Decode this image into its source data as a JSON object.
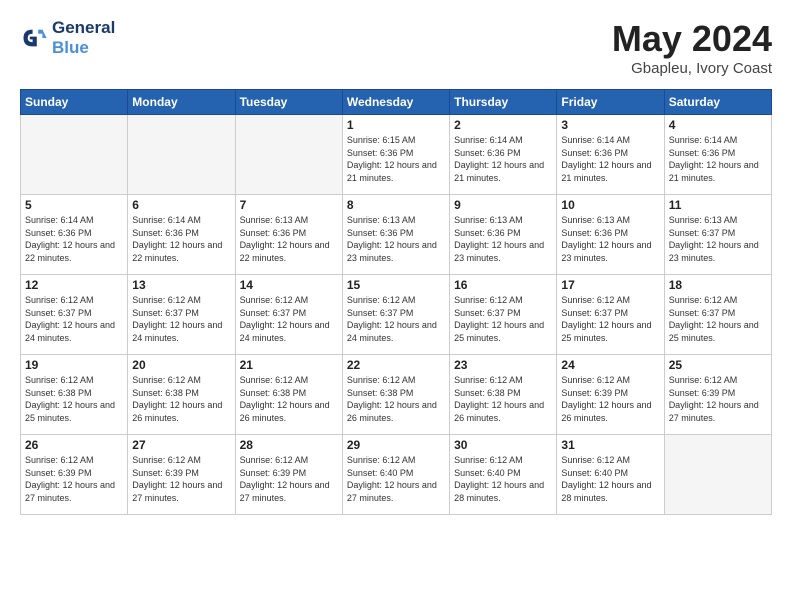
{
  "header": {
    "logo_line1": "General",
    "logo_line2": "Blue",
    "month_title": "May 2024",
    "location": "Gbapleu, Ivory Coast"
  },
  "weekdays": [
    "Sunday",
    "Monday",
    "Tuesday",
    "Wednesday",
    "Thursday",
    "Friday",
    "Saturday"
  ],
  "weeks": [
    [
      {
        "day": "",
        "empty": true
      },
      {
        "day": "",
        "empty": true
      },
      {
        "day": "",
        "empty": true
      },
      {
        "day": "1",
        "sunrise": "6:15 AM",
        "sunset": "6:36 PM",
        "daylight": "12 hours and 21 minutes."
      },
      {
        "day": "2",
        "sunrise": "6:14 AM",
        "sunset": "6:36 PM",
        "daylight": "12 hours and 21 minutes."
      },
      {
        "day": "3",
        "sunrise": "6:14 AM",
        "sunset": "6:36 PM",
        "daylight": "12 hours and 21 minutes."
      },
      {
        "day": "4",
        "sunrise": "6:14 AM",
        "sunset": "6:36 PM",
        "daylight": "12 hours and 21 minutes."
      }
    ],
    [
      {
        "day": "5",
        "sunrise": "6:14 AM",
        "sunset": "6:36 PM",
        "daylight": "12 hours and 22 minutes."
      },
      {
        "day": "6",
        "sunrise": "6:14 AM",
        "sunset": "6:36 PM",
        "daylight": "12 hours and 22 minutes."
      },
      {
        "day": "7",
        "sunrise": "6:13 AM",
        "sunset": "6:36 PM",
        "daylight": "12 hours and 22 minutes."
      },
      {
        "day": "8",
        "sunrise": "6:13 AM",
        "sunset": "6:36 PM",
        "daylight": "12 hours and 23 minutes."
      },
      {
        "day": "9",
        "sunrise": "6:13 AM",
        "sunset": "6:36 PM",
        "daylight": "12 hours and 23 minutes."
      },
      {
        "day": "10",
        "sunrise": "6:13 AM",
        "sunset": "6:36 PM",
        "daylight": "12 hours and 23 minutes."
      },
      {
        "day": "11",
        "sunrise": "6:13 AM",
        "sunset": "6:37 PM",
        "daylight": "12 hours and 23 minutes."
      }
    ],
    [
      {
        "day": "12",
        "sunrise": "6:12 AM",
        "sunset": "6:37 PM",
        "daylight": "12 hours and 24 minutes."
      },
      {
        "day": "13",
        "sunrise": "6:12 AM",
        "sunset": "6:37 PM",
        "daylight": "12 hours and 24 minutes."
      },
      {
        "day": "14",
        "sunrise": "6:12 AM",
        "sunset": "6:37 PM",
        "daylight": "12 hours and 24 minutes."
      },
      {
        "day": "15",
        "sunrise": "6:12 AM",
        "sunset": "6:37 PM",
        "daylight": "12 hours and 24 minutes."
      },
      {
        "day": "16",
        "sunrise": "6:12 AM",
        "sunset": "6:37 PM",
        "daylight": "12 hours and 25 minutes."
      },
      {
        "day": "17",
        "sunrise": "6:12 AM",
        "sunset": "6:37 PM",
        "daylight": "12 hours and 25 minutes."
      },
      {
        "day": "18",
        "sunrise": "6:12 AM",
        "sunset": "6:37 PM",
        "daylight": "12 hours and 25 minutes."
      }
    ],
    [
      {
        "day": "19",
        "sunrise": "6:12 AM",
        "sunset": "6:38 PM",
        "daylight": "12 hours and 25 minutes."
      },
      {
        "day": "20",
        "sunrise": "6:12 AM",
        "sunset": "6:38 PM",
        "daylight": "12 hours and 26 minutes."
      },
      {
        "day": "21",
        "sunrise": "6:12 AM",
        "sunset": "6:38 PM",
        "daylight": "12 hours and 26 minutes."
      },
      {
        "day": "22",
        "sunrise": "6:12 AM",
        "sunset": "6:38 PM",
        "daylight": "12 hours and 26 minutes."
      },
      {
        "day": "23",
        "sunrise": "6:12 AM",
        "sunset": "6:38 PM",
        "daylight": "12 hours and 26 minutes."
      },
      {
        "day": "24",
        "sunrise": "6:12 AM",
        "sunset": "6:39 PM",
        "daylight": "12 hours and 26 minutes."
      },
      {
        "day": "25",
        "sunrise": "6:12 AM",
        "sunset": "6:39 PM",
        "daylight": "12 hours and 27 minutes."
      }
    ],
    [
      {
        "day": "26",
        "sunrise": "6:12 AM",
        "sunset": "6:39 PM",
        "daylight": "12 hours and 27 minutes."
      },
      {
        "day": "27",
        "sunrise": "6:12 AM",
        "sunset": "6:39 PM",
        "daylight": "12 hours and 27 minutes."
      },
      {
        "day": "28",
        "sunrise": "6:12 AM",
        "sunset": "6:39 PM",
        "daylight": "12 hours and 27 minutes."
      },
      {
        "day": "29",
        "sunrise": "6:12 AM",
        "sunset": "6:40 PM",
        "daylight": "12 hours and 27 minutes."
      },
      {
        "day": "30",
        "sunrise": "6:12 AM",
        "sunset": "6:40 PM",
        "daylight": "12 hours and 28 minutes."
      },
      {
        "day": "31",
        "sunrise": "6:12 AM",
        "sunset": "6:40 PM",
        "daylight": "12 hours and 28 minutes."
      },
      {
        "day": "",
        "empty": true
      }
    ]
  ]
}
